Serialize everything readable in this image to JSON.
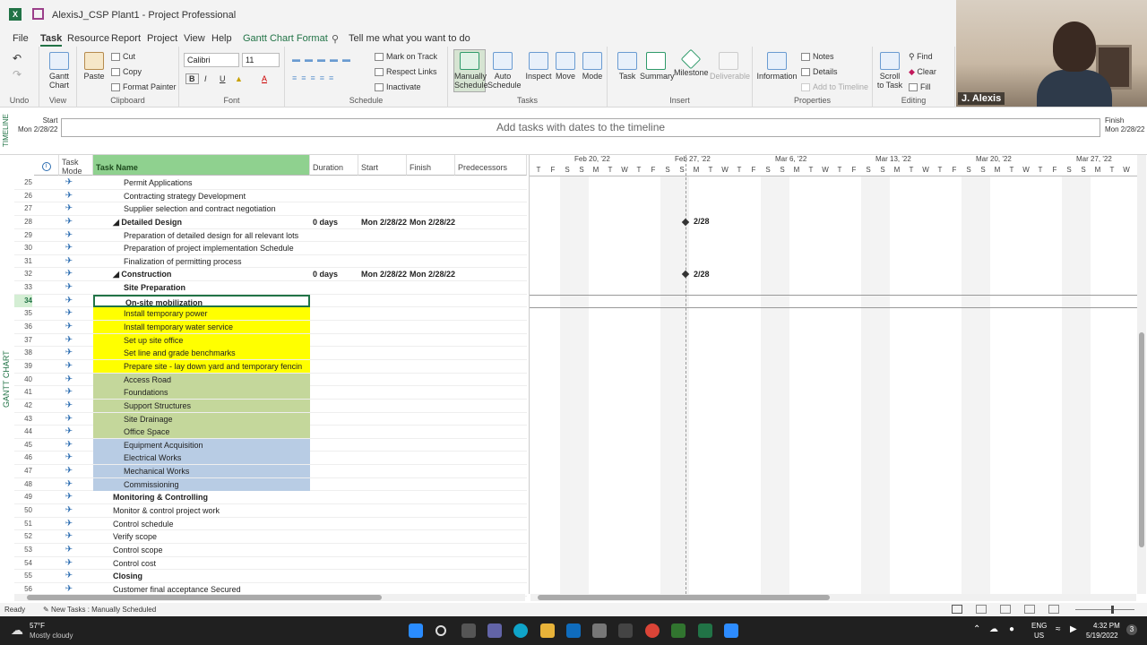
{
  "window": {
    "title": "AlexisJ_CSP Plant1  -  Project Professional"
  },
  "menu": {
    "items": [
      "File",
      "Task",
      "Resource",
      "Report",
      "Project",
      "View",
      "Help",
      "Gantt Chart Format"
    ],
    "search": "Tell me what you want to do"
  },
  "ribbon": {
    "groups": {
      "undo": "Undo",
      "view": "View",
      "clipboard": "Clipboard",
      "font": "Font",
      "schedule": "Schedule",
      "tasks": "Tasks",
      "insert": "Insert",
      "properties": "Properties",
      "editing": "Editing"
    },
    "buttons": {
      "gantt_chart": "Gantt Chart",
      "paste": "Paste",
      "cut": "Cut",
      "copy": "Copy",
      "format_painter": "Format Painter",
      "font_name": "Calibri",
      "font_size": "11",
      "mark_on_track": "Mark on Track",
      "respect_links": "Respect Links",
      "inactivate": "Inactivate",
      "manually_schedule": "Manually Schedule",
      "auto_schedule": "Auto Schedule",
      "inspect": "Inspect",
      "move": "Move",
      "mode": "Mode",
      "task": "Task",
      "summary": "Summary",
      "milestone": "Milestone",
      "deliverable": "Deliverable",
      "information": "Information",
      "notes": "Notes",
      "details": "Details",
      "add_to_timeline": "Add to Timeline",
      "scroll_to_task": "Scroll to Task",
      "find": "Find",
      "clear": "Clear",
      "fill": "Fill"
    }
  },
  "timeline": {
    "side_label": "TIMELINE",
    "start_label": "Start",
    "start_date": "Mon 2/28/22",
    "finish_label": "Finish",
    "finish_date": "Mon 2/28/22",
    "placeholder": "Add tasks with dates to the timeline"
  },
  "gantt": {
    "side_label": "GANTT CHART",
    "columns": {
      "task_mode": "Task Mode",
      "task_name": "Task Name",
      "duration": "Duration",
      "start": "Start",
      "finish": "Finish",
      "predecessors": "Predecessors"
    },
    "weeks": [
      "Feb 20, '22",
      "Feb 27, '22",
      "Mar 6, '22",
      "Mar 13, '22",
      "Mar 20, '22",
      "Mar 27, '22"
    ],
    "day_letters": [
      "T",
      "F",
      "S",
      "S",
      "M",
      "T",
      "W",
      "T",
      "F",
      "S",
      "S",
      "M",
      "T",
      "W",
      "T",
      "F",
      "S",
      "S",
      "M",
      "T",
      "W",
      "T",
      "F",
      "S",
      "S",
      "M",
      "T",
      "W",
      "T",
      "F",
      "S",
      "S",
      "M",
      "T",
      "W",
      "T",
      "F",
      "S",
      "S",
      "M",
      "T",
      "W"
    ],
    "rows": [
      {
        "id": "25",
        "name": "Permit Applications",
        "indent": 2,
        "style": ""
      },
      {
        "id": "26",
        "name": "Contracting strategy Development",
        "indent": 2,
        "style": ""
      },
      {
        "id": "27",
        "name": "Supplier selection and contract negotiation",
        "indent": 2,
        "style": ""
      },
      {
        "id": "28",
        "name": "◢ Detailed Design",
        "indent": 1,
        "style": "bold",
        "duration": "0 days",
        "start": "Mon 2/28/22",
        "finish": "Mon 2/28/22",
        "milestone": "2/28"
      },
      {
        "id": "29",
        "name": "Preparation of detailed design for all relevant lots",
        "indent": 2,
        "style": ""
      },
      {
        "id": "30",
        "name": "Preparation of project implementation Schedule",
        "indent": 2,
        "style": ""
      },
      {
        "id": "31",
        "name": "Finalization of permitting process",
        "indent": 2,
        "style": ""
      },
      {
        "id": "32",
        "name": "◢ Construction",
        "indent": 1,
        "style": "bold",
        "duration": "0 days",
        "start": "Mon 2/28/22",
        "finish": "Mon 2/28/22",
        "milestone": "2/28"
      },
      {
        "id": "33",
        "name": "Site Preparation",
        "indent": 2,
        "style": "bold"
      },
      {
        "id": "34",
        "name": "On-site mobilization",
        "indent": 2,
        "style": "bold",
        "selected": true
      },
      {
        "id": "35",
        "name": "Install temporary power",
        "indent": 2,
        "style": "yellow"
      },
      {
        "id": "36",
        "name": "Install temporary water service",
        "indent": 2,
        "style": "yellow"
      },
      {
        "id": "37",
        "name": "Set up site office",
        "indent": 2,
        "style": "yellow"
      },
      {
        "id": "38",
        "name": "Set line and grade benchmarks",
        "indent": 2,
        "style": "yellow"
      },
      {
        "id": "39",
        "name": "Prepare site - lay down yard and temporary fencin",
        "indent": 2,
        "style": "yellow"
      },
      {
        "id": "40",
        "name": "Access Road",
        "indent": 2,
        "style": "green"
      },
      {
        "id": "41",
        "name": "Foundations",
        "indent": 2,
        "style": "green"
      },
      {
        "id": "42",
        "name": "Support Structures",
        "indent": 2,
        "style": "green"
      },
      {
        "id": "43",
        "name": "Site Drainage",
        "indent": 2,
        "style": "green"
      },
      {
        "id": "44",
        "name": "Office Space",
        "indent": 2,
        "style": "green"
      },
      {
        "id": "45",
        "name": "Equipment Acquisition",
        "indent": 2,
        "style": "blue"
      },
      {
        "id": "46",
        "name": "Electrical Works",
        "indent": 2,
        "style": "blue"
      },
      {
        "id": "47",
        "name": "Mechanical Works",
        "indent": 2,
        "style": "blue"
      },
      {
        "id": "48",
        "name": "Commissioning",
        "indent": 2,
        "style": "blue"
      },
      {
        "id": "49",
        "name": "Monitoring & Controlling",
        "indent": 1,
        "style": "bold"
      },
      {
        "id": "50",
        "name": "Monitor & control project work",
        "indent": 1,
        "style": ""
      },
      {
        "id": "51",
        "name": "Control schedule",
        "indent": 1,
        "style": ""
      },
      {
        "id": "52",
        "name": "Verify scope",
        "indent": 1,
        "style": ""
      },
      {
        "id": "53",
        "name": "Control scope",
        "indent": 1,
        "style": ""
      },
      {
        "id": "54",
        "name": "Control cost",
        "indent": 1,
        "style": ""
      },
      {
        "id": "55",
        "name": "Closing",
        "indent": 1,
        "style": "bold"
      },
      {
        "id": "56",
        "name": "Customer final acceptance Secured",
        "indent": 1,
        "style": ""
      }
    ]
  },
  "status": {
    "ready": "Ready",
    "new_tasks": "New Tasks : Manually Scheduled"
  },
  "taskbar": {
    "weather_temp": "57°F",
    "weather_desc": "Mostly cloudy",
    "lang1": "ENG",
    "lang2": "US",
    "time": "4:32 PM",
    "date": "5/19/2022",
    "notif_count": "3"
  },
  "webcam": {
    "name": "J. Alexis"
  }
}
